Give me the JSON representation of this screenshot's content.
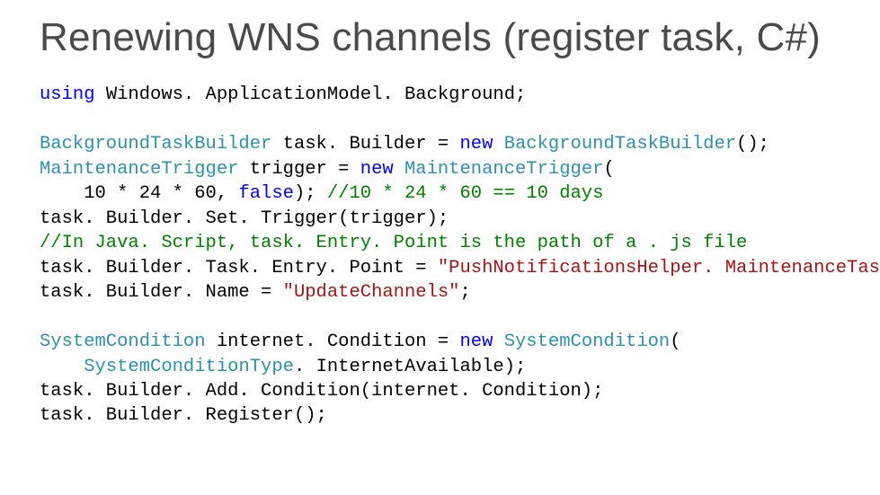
{
  "title": "Renewing WNS channels (register task, C#)",
  "code": {
    "l01_kw_using": "using",
    "l01_rest": " Windows. ApplicationModel. Background;",
    "blank1": "",
    "l02_type1": "BackgroundTaskBuilder",
    "l02_mid": " task. Builder = ",
    "l02_kw_new": "new",
    "l02_sp": " ",
    "l02_type2": "BackgroundTaskBuilder",
    "l02_end": "();",
    "l03_type": "MaintenanceTrigger",
    "l03_mid": " trigger = ",
    "l03_kw_new": "new",
    "l03_sp": " ",
    "l03_type2": "MaintenanceTrigger",
    "l03_end": "(",
    "l04_lead": "    10 * 24 * 60, ",
    "l04_kw_false": "false",
    "l04_post": "); ",
    "l04_comment": "//10 * 24 * 60 == 10 days",
    "l05": "task. Builder. Set. Trigger(trigger);",
    "l06_comment": "//In Java. Script, task. Entry. Point is the path of a . js file",
    "l07_pre": "task. Builder. Task. Entry. Point = ",
    "l07_str": "\"PushNotificationsHelper. MaintenanceTask\"",
    "l07_end": ";",
    "l08_pre": "task. Builder. Name = ",
    "l08_str": "\"UpdateChannels\"",
    "l08_end": ";",
    "blank2": "",
    "l09_type": "SystemCondition",
    "l09_mid": " internet. Condition = ",
    "l09_kw_new": "new",
    "l09_sp": " ",
    "l09_type2": "SystemCondition",
    "l09_end": "(",
    "l10_lead": "    ",
    "l10_type": "SystemConditionType",
    "l10_end": ". InternetAvailable);",
    "l11": "task. Builder. Add. Condition(internet. Condition);",
    "l12": "task. Builder. Register();"
  }
}
